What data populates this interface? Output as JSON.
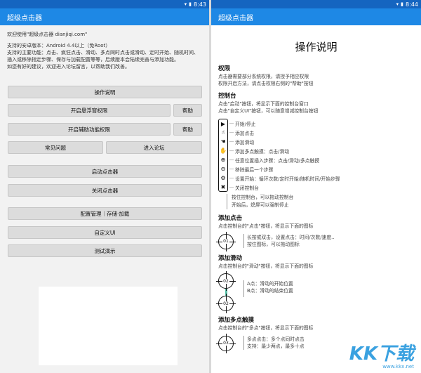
{
  "left": {
    "status_time": "8:43",
    "app_title": "超级点击器",
    "intro": [
      "欢迎使用\"超级点击器 dianjiqi.com\"",
      "支持的安卓版本：Android 4.4以上（免Root）",
      "支持的主要功能：点击、疯狂点击、滑动、多点同时点击或滑动、定时开始、随机时间、插入或移除指定步骤、保存与加载配置等等，后续版本会陆续完善与添加功能。",
      "如您有好的建议，欢迎进入论坛留言，以帮助我们改善。"
    ],
    "buttons": {
      "manual": "操作说明",
      "float_perm": "开启悬浮窗权限",
      "help1": "帮助",
      "access_perm": "开启辅助功能权限",
      "help2": "帮助",
      "faq": "常见问题",
      "forum": "进入论坛",
      "start": "启动点击器",
      "stop": "关闭点击器",
      "config": "配置管理｜存储·加载",
      "custom_ui": "自定义UI",
      "demo": "测试演示"
    }
  },
  "right": {
    "status_time": "8:44",
    "app_title": "超级点击器",
    "page_title": "操作说明",
    "perm": {
      "title": "权限",
      "lines": [
        "点击器需要部分系统权限，请授予相应权限",
        "权限开启方法，请点击权限右侧的\"帮助\"按钮"
      ]
    },
    "panel": {
      "title": "控制台",
      "lines": [
        "点击\"启动\"按钮，将显示下面的控制台窗口",
        "点击\"自定义UI\"按钮，可以随意增减控制台按钮"
      ],
      "items": [
        {
          "glyph": "▶",
          "icon": "play-icon",
          "label": "开始/停止"
        },
        {
          "glyph": "☝",
          "icon": "add-click-icon",
          "label": "添加点击"
        },
        {
          "glyph": "☚",
          "icon": "add-swipe-icon",
          "label": "添加滑动"
        },
        {
          "glyph": "✋",
          "icon": "multi-touch-icon",
          "label": "添加多点触摸：点击/滑动"
        },
        {
          "glyph": "⊕",
          "icon": "insert-step-icon",
          "label": "任意位置插入步骤：点击/滑动/多点触摸"
        },
        {
          "glyph": "⊖",
          "icon": "remove-step-icon",
          "label": "移除最后一个步骤"
        },
        {
          "glyph": "⚙",
          "icon": "settings-icon",
          "label": "设置开始：循环次数/定时开始/随机时间/开始步骤"
        },
        {
          "glyph": "✖",
          "icon": "close-icon",
          "label": "关闭控制台"
        }
      ],
      "notes": [
        "按住控制台，可以拖动控制台",
        "开始后，熄屏可以强制停止"
      ]
    },
    "click": {
      "title": "添加点击",
      "line": "点击控制台的\"点击\"按钮，将显示下面的图标",
      "target_label": "01",
      "notes": [
        "长按或双击，设置点击：时间/次数/速度..",
        "按住图标，可以拖动图标"
      ]
    },
    "swipe": {
      "title": "添加滑动",
      "line": "点击控制台的\"滑动\"按钮，将显示下面的图标",
      "a_label": "02",
      "b_label": "02",
      "notes": [
        "A点：滑动的开始位置",
        "B点：滑动的结束位置"
      ]
    },
    "multi": {
      "title": "添加多点触摸",
      "line": "点击控制台的\"多点\"按钮，将显示下面的图标",
      "target_label": "03",
      "notes": [
        "多点点击：多个点同时点击",
        "支持：最少两点，最多十点"
      ]
    },
    "watermark": {
      "big": "KK下载",
      "small": "www.kkx.net"
    }
  }
}
